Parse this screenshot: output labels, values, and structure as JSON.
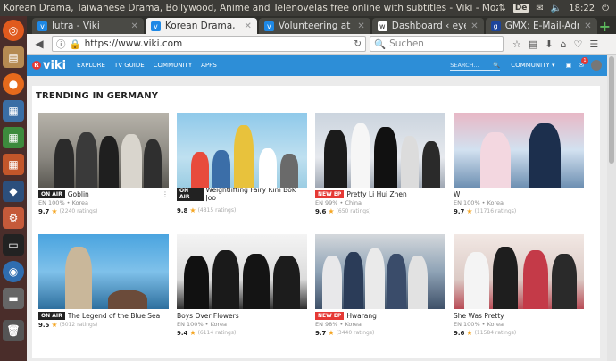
{
  "panel": {
    "window_title": "Korean Drama, Taiwanese Drama, Bollywood, Anime and Telenovelas free online with subtitles - Viki - Mozilla Firefox",
    "keyboard": "De",
    "time": "18:22"
  },
  "tabs": [
    {
      "label": "lutra - Viki",
      "favicon": "v",
      "active": false
    },
    {
      "label": "Korean Drama, ...",
      "favicon": "v",
      "active": true
    },
    {
      "label": "Volunteering at ...",
      "favicon": "v",
      "active": false
    },
    {
      "label": "Dashboard ‹ eye...",
      "favicon": "w",
      "active": false
    },
    {
      "label": "GMX: E-Mail-Adr...",
      "favicon": "g",
      "active": false
    }
  ],
  "nav": {
    "url": "https://www.viki.com",
    "search_placeholder": "Suchen"
  },
  "viki": {
    "logo": "viki",
    "menu": [
      "EXPLORE",
      "TV GUIDE",
      "COMMUNITY",
      "APPS"
    ],
    "search_placeholder": "SEARCH...",
    "community": "COMMUNITY ▾",
    "notifications": "1"
  },
  "section_title": "TRENDING IN GERMANY",
  "shows": [
    {
      "tag": "ON AIR",
      "title": "Goblin",
      "info": "EN 100% • Korea",
      "score": "9.7",
      "ratings": "(2240 ratings)"
    },
    {
      "tag": "ON AIR",
      "title": "Weightlifting Fairy Kim Bok Joo",
      "info": "EN 100% • Korea",
      "score": "9.8",
      "ratings": "(4815 ratings)"
    },
    {
      "tag": "NEW EP",
      "title": "Pretty Li Hui Zhen",
      "info": "EN 99% • China",
      "score": "9.6",
      "ratings": "(650 ratings)"
    },
    {
      "tag": "",
      "title": "W",
      "info": "EN 100% • Korea",
      "score": "9.7",
      "ratings": "(11716 ratings)"
    },
    {
      "tag": "ON AIR",
      "title": "The Legend of the Blue Sea",
      "info": "EN 100% • Korea",
      "score": "9.5",
      "ratings": "(6012 ratings)"
    },
    {
      "tag": "",
      "title": "Boys Over Flowers",
      "info": "EN 100% • Korea",
      "score": "9.4",
      "ratings": "(6114 ratings)"
    },
    {
      "tag": "NEW EP",
      "title": "Hwarang",
      "info": "EN 98% • Korea",
      "score": "9.7",
      "ratings": "(3440 ratings)"
    },
    {
      "tag": "",
      "title": "She Was Pretty",
      "info": "EN 100% • Korea",
      "score": "9.6",
      "ratings": "(11584 ratings)"
    }
  ]
}
